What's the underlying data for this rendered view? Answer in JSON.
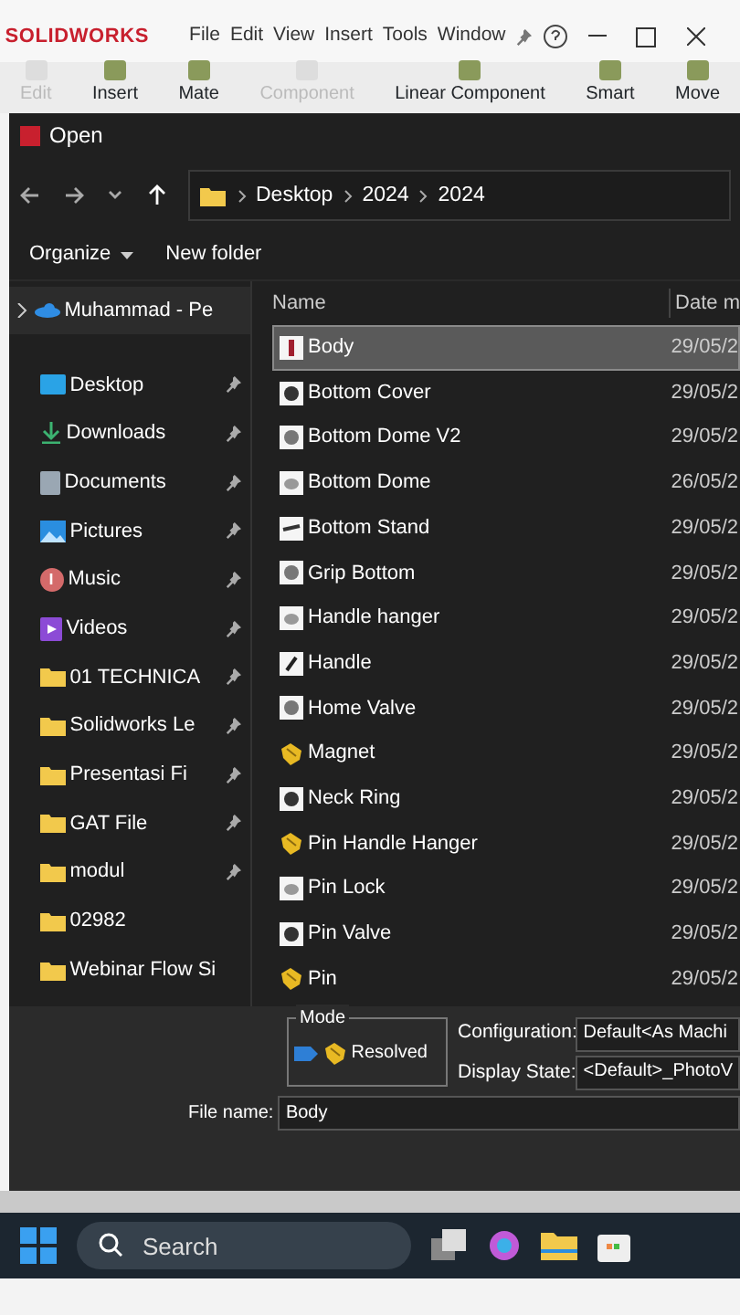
{
  "app": {
    "logo": "SOLIDWORKS",
    "menu": [
      "File",
      "Edit",
      "View",
      "Insert",
      "Tools",
      "Window"
    ]
  },
  "toolbar": [
    {
      "label": "Edit",
      "disabled": true
    },
    {
      "label": "Insert",
      "disabled": false
    },
    {
      "label": "Mate",
      "disabled": false
    },
    {
      "label": "Component",
      "disabled": true
    },
    {
      "label": "Linear Component",
      "disabled": false
    },
    {
      "label": "Smart",
      "disabled": false
    },
    {
      "label": "Move",
      "disabled": false
    }
  ],
  "dialog": {
    "title": "Open",
    "breadcrumb": [
      "Desktop",
      "2024",
      "2024"
    ],
    "commands": [
      "Organize",
      "New folder"
    ],
    "sidebar": [
      {
        "label": "Muhammad - Pe",
        "kind": "cloud",
        "pinned": false
      },
      {
        "label": "Desktop",
        "kind": "desktop",
        "pinned": true
      },
      {
        "label": "Downloads",
        "kind": "downloads",
        "pinned": true
      },
      {
        "label": "Documents",
        "kind": "documents",
        "pinned": true
      },
      {
        "label": "Pictures",
        "kind": "pictures",
        "pinned": true
      },
      {
        "label": "Music",
        "kind": "music",
        "pinned": true
      },
      {
        "label": "Videos",
        "kind": "videos",
        "pinned": true
      },
      {
        "label": "01 TECHNICA",
        "kind": "folder",
        "pinned": true
      },
      {
        "label": "Solidworks Le",
        "kind": "folder",
        "pinned": true
      },
      {
        "label": "Presentasi Fi",
        "kind": "folder",
        "pinned": true
      },
      {
        "label": "GAT File",
        "kind": "folder",
        "pinned": true
      },
      {
        "label": "modul",
        "kind": "folder",
        "pinned": true
      },
      {
        "label": "02982",
        "kind": "folder",
        "pinned": false
      },
      {
        "label": "Webinar Flow Si",
        "kind": "folder",
        "pinned": false
      }
    ],
    "columns": [
      "Name",
      "Date m"
    ],
    "files": [
      {
        "name": "Body",
        "date": "29/05/2",
        "kind": "part",
        "selected": true
      },
      {
        "name": "Bottom Cover",
        "date": "29/05/2",
        "kind": "part",
        "selected": false
      },
      {
        "name": "Bottom Dome V2",
        "date": "29/05/2",
        "kind": "part",
        "selected": false
      },
      {
        "name": "Bottom Dome",
        "date": "26/05/2",
        "kind": "part",
        "selected": false
      },
      {
        "name": "Bottom Stand",
        "date": "29/05/2",
        "kind": "part",
        "selected": false
      },
      {
        "name": "Grip Bottom",
        "date": "29/05/2",
        "kind": "part",
        "selected": false
      },
      {
        "name": "Handle hanger",
        "date": "29/05/2",
        "kind": "part",
        "selected": false
      },
      {
        "name": "Handle",
        "date": "29/05/2",
        "kind": "part",
        "selected": false
      },
      {
        "name": "Home Valve",
        "date": "29/05/2",
        "kind": "part",
        "selected": false
      },
      {
        "name": "Magnet",
        "date": "29/05/2",
        "kind": "assembly",
        "selected": false
      },
      {
        "name": "Neck Ring",
        "date": "29/05/2",
        "kind": "part",
        "selected": false
      },
      {
        "name": "Pin Handle Hanger",
        "date": "29/05/2",
        "kind": "assembly",
        "selected": false
      },
      {
        "name": "Pin Lock",
        "date": "29/05/2",
        "kind": "part",
        "selected": false
      },
      {
        "name": "Pin Valve",
        "date": "29/05/2",
        "kind": "part",
        "selected": false
      },
      {
        "name": "Pin",
        "date": "29/05/2",
        "kind": "assembly",
        "selected": false
      }
    ],
    "mode": {
      "legend": "Mode",
      "value": "Resolved"
    },
    "configuration": {
      "label": "Configuration:",
      "value": "Default<As Machi"
    },
    "display_state": {
      "label": "Display State:",
      "value": "<Default>_PhotoV"
    },
    "file_name": {
      "label": "File name:",
      "value": "Body"
    }
  },
  "taskbar": {
    "search": {
      "placeholder": "Search"
    }
  }
}
